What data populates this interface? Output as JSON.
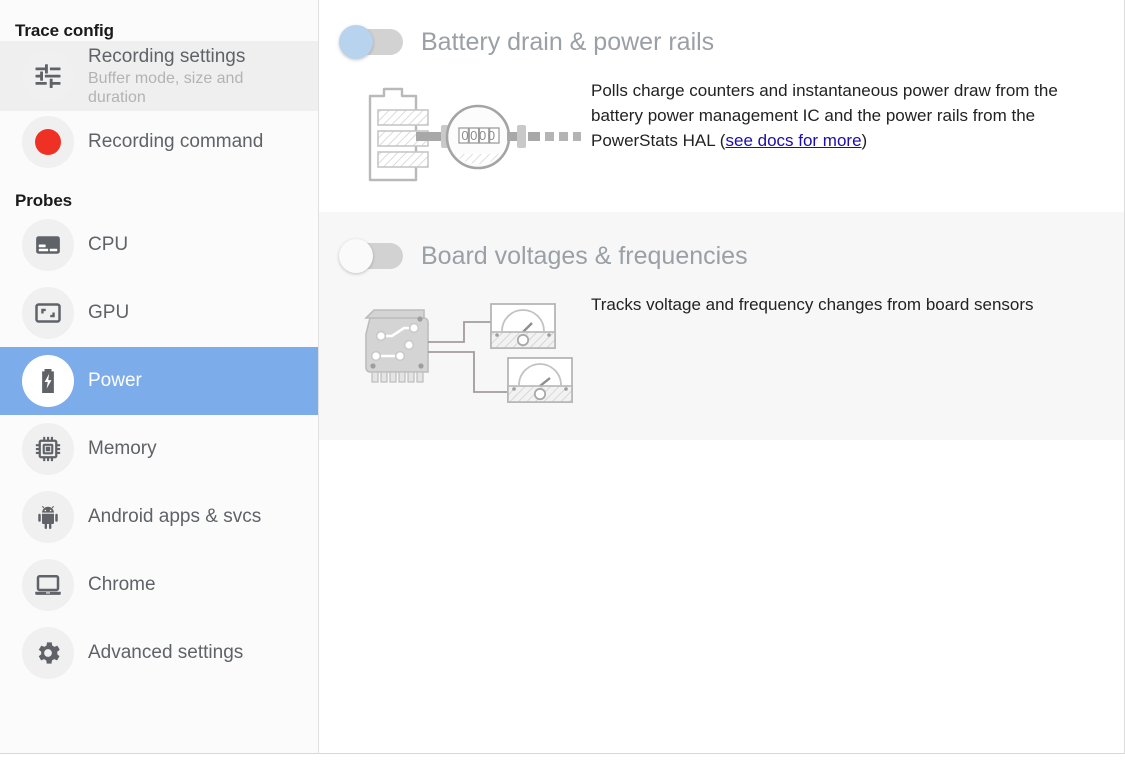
{
  "sidebar": {
    "trace_config_title": "Trace config",
    "probes_title": "Probes",
    "config_items": [
      {
        "id": "recording-settings",
        "label": "Recording settings",
        "sublabel": "Buffer mode, size and duration",
        "icon": "tune-sliders-icon",
        "state": "hovered"
      },
      {
        "id": "recording-command",
        "label": "Recording command",
        "icon": "record-circle-icon",
        "state": "normal"
      }
    ],
    "probe_items": [
      {
        "id": "cpu",
        "label": "CPU",
        "icon": "cpu-icon",
        "state": "normal"
      },
      {
        "id": "gpu",
        "label": "GPU",
        "icon": "gpu-icon",
        "state": "normal"
      },
      {
        "id": "power",
        "label": "Power",
        "icon": "battery-bolt-icon",
        "state": "active"
      },
      {
        "id": "memory",
        "label": "Memory",
        "icon": "memory-chip-icon",
        "state": "normal"
      },
      {
        "id": "android-apps-svcs",
        "label": "Android apps & svcs",
        "icon": "android-icon",
        "state": "normal"
      },
      {
        "id": "chrome",
        "label": "Chrome",
        "icon": "laptop-icon",
        "state": "normal"
      },
      {
        "id": "advanced-settings",
        "label": "Advanced settings",
        "icon": "gear-icon",
        "state": "normal"
      }
    ]
  },
  "main": {
    "probes": [
      {
        "id": "battery-drain-power-rails",
        "title": "Battery drain & power rails",
        "toggle_state": "on",
        "illustration": "battery-meter-illustration",
        "description_pre": "Polls charge counters and instantaneous power draw from the battery power management IC and the power rails from the PowerStats HAL (",
        "link_text": "see docs for more",
        "description_post": ")",
        "meter_digits": "0000"
      },
      {
        "id": "board-voltages-frequencies",
        "title": "Board voltages & frequencies",
        "toggle_state": "off",
        "illustration": "board-gauges-illustration",
        "description_pre": "Tracks voltage and frequency changes from board sensors",
        "link_text": "",
        "description_post": ""
      }
    ]
  },
  "colors": {
    "accent_blue": "#7cace9",
    "toggle_on_knob": "#b7d3ee",
    "toggle_track": "#d2d2d2",
    "record_red": "#ee3124",
    "link_blue": "#1a0dab",
    "shaded_section": "#f7f7f7"
  }
}
